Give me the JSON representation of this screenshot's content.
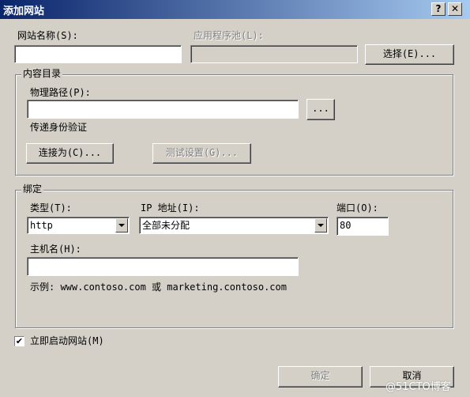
{
  "window": {
    "title": "添加网站",
    "help_glyph": "?",
    "close_glyph": "✕"
  },
  "site_name": {
    "label": "网站名称(S):",
    "value": ""
  },
  "app_pool": {
    "label": "应用程序池(L):",
    "value": "",
    "select_label": "选择(E)..."
  },
  "content_dir": {
    "legend": "内容目录",
    "physical_path_label": "物理路径(P):",
    "physical_path_value": "",
    "browse_label": "...",
    "pass_auth_label": "传递身份验证",
    "connect_as_label": "连接为(C)...",
    "test_settings_label": "测试设置(G)..."
  },
  "binding": {
    "legend": "绑定",
    "type_label": "类型(T):",
    "type_value": "http",
    "ip_label": "IP 地址(I):",
    "ip_value": "全部未分配",
    "port_label": "端口(O):",
    "port_value": "80",
    "hostname_label": "主机名(H):",
    "hostname_value": "",
    "example": "示例: www.contoso.com 或 marketing.contoso.com"
  },
  "start_now": {
    "label": "立即启动网站(M)",
    "checked": true,
    "check_glyph": "✔"
  },
  "footer": {
    "ok_label": "确定",
    "cancel_label": "取消"
  },
  "watermark": "@51CTO博客"
}
